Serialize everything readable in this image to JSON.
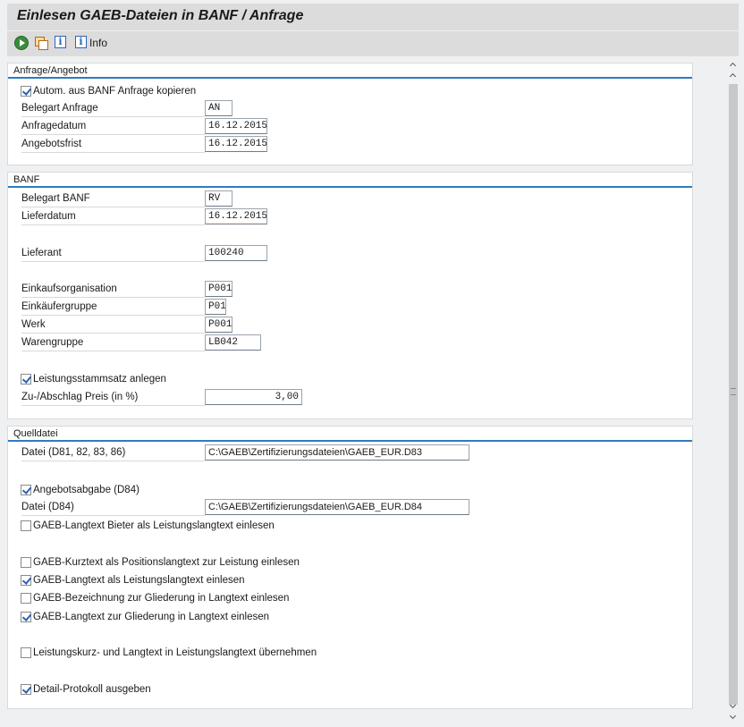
{
  "title": "Einlesen GAEB-Dateien in BANF / Anfrage",
  "toolbar": {
    "info_label": "Info",
    "icons": [
      "execute-icon",
      "copy-variant-icon",
      "info-icon",
      "info-icon"
    ]
  },
  "anfrage": {
    "title": "Anfrage/Angebot",
    "auto_copy": {
      "label": "Autom. aus BANF Anfrage kopieren",
      "checked": true
    },
    "belegart": {
      "label": "Belegart Anfrage",
      "value": "AN"
    },
    "anfragedatum": {
      "label": "Anfragedatum",
      "value": "16.12.2015"
    },
    "angebotsfrist": {
      "label": "Angebotsfrist",
      "value": "16.12.2015"
    }
  },
  "banf": {
    "title": "BANF",
    "belegart": {
      "label": "Belegart BANF",
      "value": "RV"
    },
    "lieferdatum": {
      "label": "Lieferdatum",
      "value": "16.12.2015"
    },
    "lieferant": {
      "label": "Lieferant",
      "value": "100240"
    },
    "einkaufsorg": {
      "label": "Einkaufsorganisation",
      "value": "P001"
    },
    "einkaeufergruppe": {
      "label": "Einkäufergruppe",
      "value": "P01"
    },
    "werk": {
      "label": "Werk",
      "value": "P001"
    },
    "warengruppe": {
      "label": "Warengruppe",
      "value": "LB042"
    },
    "leistungsstamm": {
      "label": "Leistungsstammsatz anlegen",
      "checked": true
    },
    "zuabschlag": {
      "label": "Zu-/Abschlag Preis (in %)",
      "value": "3,00"
    }
  },
  "quelldatei": {
    "title": "Quelldatei",
    "datei": {
      "label": "Datei (D81, 82, 83, 86)",
      "value": "C:\\GAEB\\Zertifizierungsdateien\\GAEB_EUR.D83"
    },
    "angebotsabgabe": {
      "label": "Angebotsabgabe (D84)",
      "checked": true
    },
    "datei84": {
      "label": "Datei (D84)",
      "value": "C:\\GAEB\\Zertifizierungsdateien\\GAEB_EUR.D84"
    },
    "cb_bieter": {
      "label": "GAEB-Langtext Bieter als Leistungslangtext einlesen",
      "checked": false
    },
    "cb_kurztext": {
      "label": "GAEB-Kurztext als Positionslangtext zur Leistung einlesen",
      "checked": false
    },
    "cb_langtext": {
      "label": "GAEB-Langtext als Leistungslangtext einlesen",
      "checked": true
    },
    "cb_bezeichnung": {
      "label": "GAEB-Bezeichnung zur Gliederung in Langtext einlesen",
      "checked": false
    },
    "cb_gliederung": {
      "label": "GAEB-Langtext zur Gliederung in Langtext einlesen",
      "checked": true
    },
    "cb_kurzlang": {
      "label": "Leistungskurz- und Langtext in Leistungslangtext übernehmen",
      "checked": false
    },
    "cb_protokoll": {
      "label": "Detail-Protokoll ausgeben",
      "checked": true
    }
  }
}
